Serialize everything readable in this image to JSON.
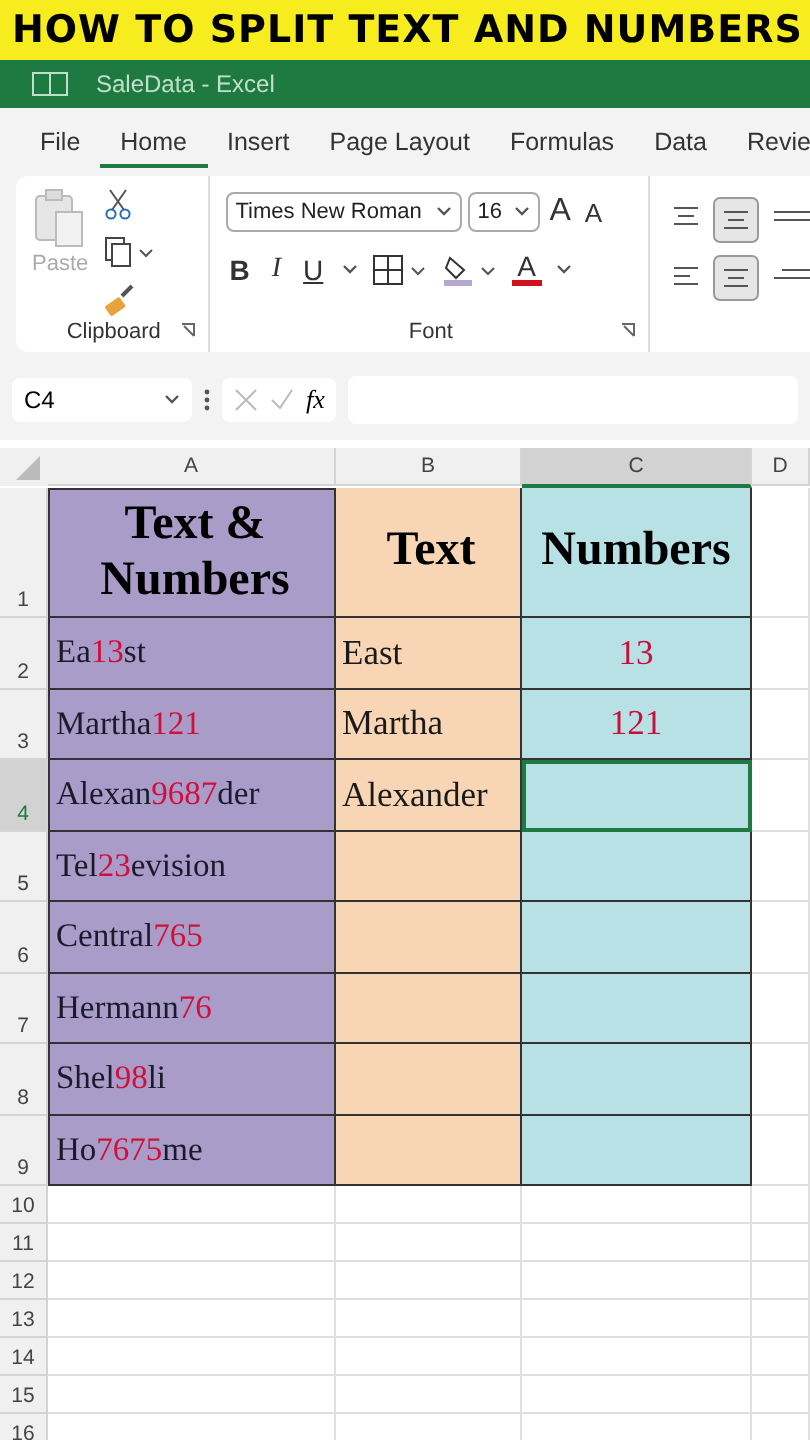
{
  "banner": "HOW TO SPLIT TEXT AND NUMBERS",
  "window": {
    "title": "SaleData - Excel"
  },
  "tabs": [
    {
      "label": "File",
      "selected": false
    },
    {
      "label": "Home",
      "selected": true
    },
    {
      "label": "Insert",
      "selected": false
    },
    {
      "label": "Page Layout",
      "selected": false
    },
    {
      "label": "Formulas",
      "selected": false
    },
    {
      "label": "Data",
      "selected": false
    },
    {
      "label": "Revie",
      "selected": false
    }
  ],
  "ribbon": {
    "paste_label": "Paste",
    "clipboard_label": "Clipboard",
    "font_label": "Font",
    "font_name": "Times New Roman",
    "font_size": "16",
    "grow_font": "A",
    "shrink_font": "A",
    "bold": "B",
    "italic": "I",
    "underline": "U",
    "font_color": "A"
  },
  "formula_bar": {
    "name_box": "C4",
    "fx": "fx"
  },
  "columns": [
    {
      "label": "A",
      "selected": false
    },
    {
      "label": "B",
      "selected": false
    },
    {
      "label": "C",
      "selected": true
    },
    {
      "label": "D",
      "selected": false
    }
  ],
  "rows": [
    {
      "kind": "header",
      "number": "1",
      "selected": false,
      "a": [
        {
          "text": "Text & Numbers",
          "number": false
        }
      ],
      "b": "Text",
      "c": "Numbers"
    },
    {
      "kind": "data",
      "number": "2",
      "selected": false,
      "a": [
        {
          "text": "Ea",
          "number": false
        },
        {
          "text": "13",
          "number": true
        },
        {
          "text": "st",
          "number": false
        }
      ],
      "b": "East",
      "c": "13"
    },
    {
      "kind": "data",
      "number": "3",
      "selected": false,
      "a": [
        {
          "text": "Martha",
          "number": false
        },
        {
          "text": "121",
          "number": true
        }
      ],
      "b": "Martha",
      "c": "121"
    },
    {
      "kind": "data",
      "number": "4",
      "selected": true,
      "a": [
        {
          "text": "Alexan",
          "number": false
        },
        {
          "text": "9687",
          "number": true
        },
        {
          "text": "der",
          "number": false
        }
      ],
      "b": "Alexander"
    },
    {
      "kind": "data",
      "number": "5",
      "selected": false,
      "a": [
        {
          "text": "Tel",
          "number": false
        },
        {
          "text": "23",
          "number": true
        },
        {
          "text": "evision",
          "number": false
        }
      ]
    },
    {
      "kind": "data",
      "number": "6",
      "selected": false,
      "a": [
        {
          "text": "Central",
          "number": false
        },
        {
          "text": "765",
          "number": true
        }
      ]
    },
    {
      "kind": "data",
      "number": "7",
      "selected": false,
      "a": [
        {
          "text": "Hermann",
          "number": false
        },
        {
          "text": "76",
          "number": true
        }
      ]
    },
    {
      "kind": "data",
      "number": "8",
      "selected": false,
      "a": [
        {
          "text": "Shel",
          "number": false
        },
        {
          "text": "98",
          "number": true
        },
        {
          "text": "li",
          "number": false
        }
      ]
    },
    {
      "kind": "data",
      "number": "9",
      "selected": false,
      "a": [
        {
          "text": "Ho",
          "number": false
        },
        {
          "text": "7675",
          "number": true
        },
        {
          "text": "me",
          "number": false
        }
      ]
    },
    {
      "kind": "empty",
      "number": "10",
      "selected": false
    },
    {
      "kind": "empty",
      "number": "11",
      "selected": false
    },
    {
      "kind": "empty",
      "number": "12",
      "selected": false
    },
    {
      "kind": "empty",
      "number": "13",
      "selected": false
    },
    {
      "kind": "empty",
      "number": "14",
      "selected": false
    },
    {
      "kind": "empty",
      "number": "15",
      "selected": false
    },
    {
      "kind": "empty",
      "number": "16",
      "selected": false
    }
  ]
}
